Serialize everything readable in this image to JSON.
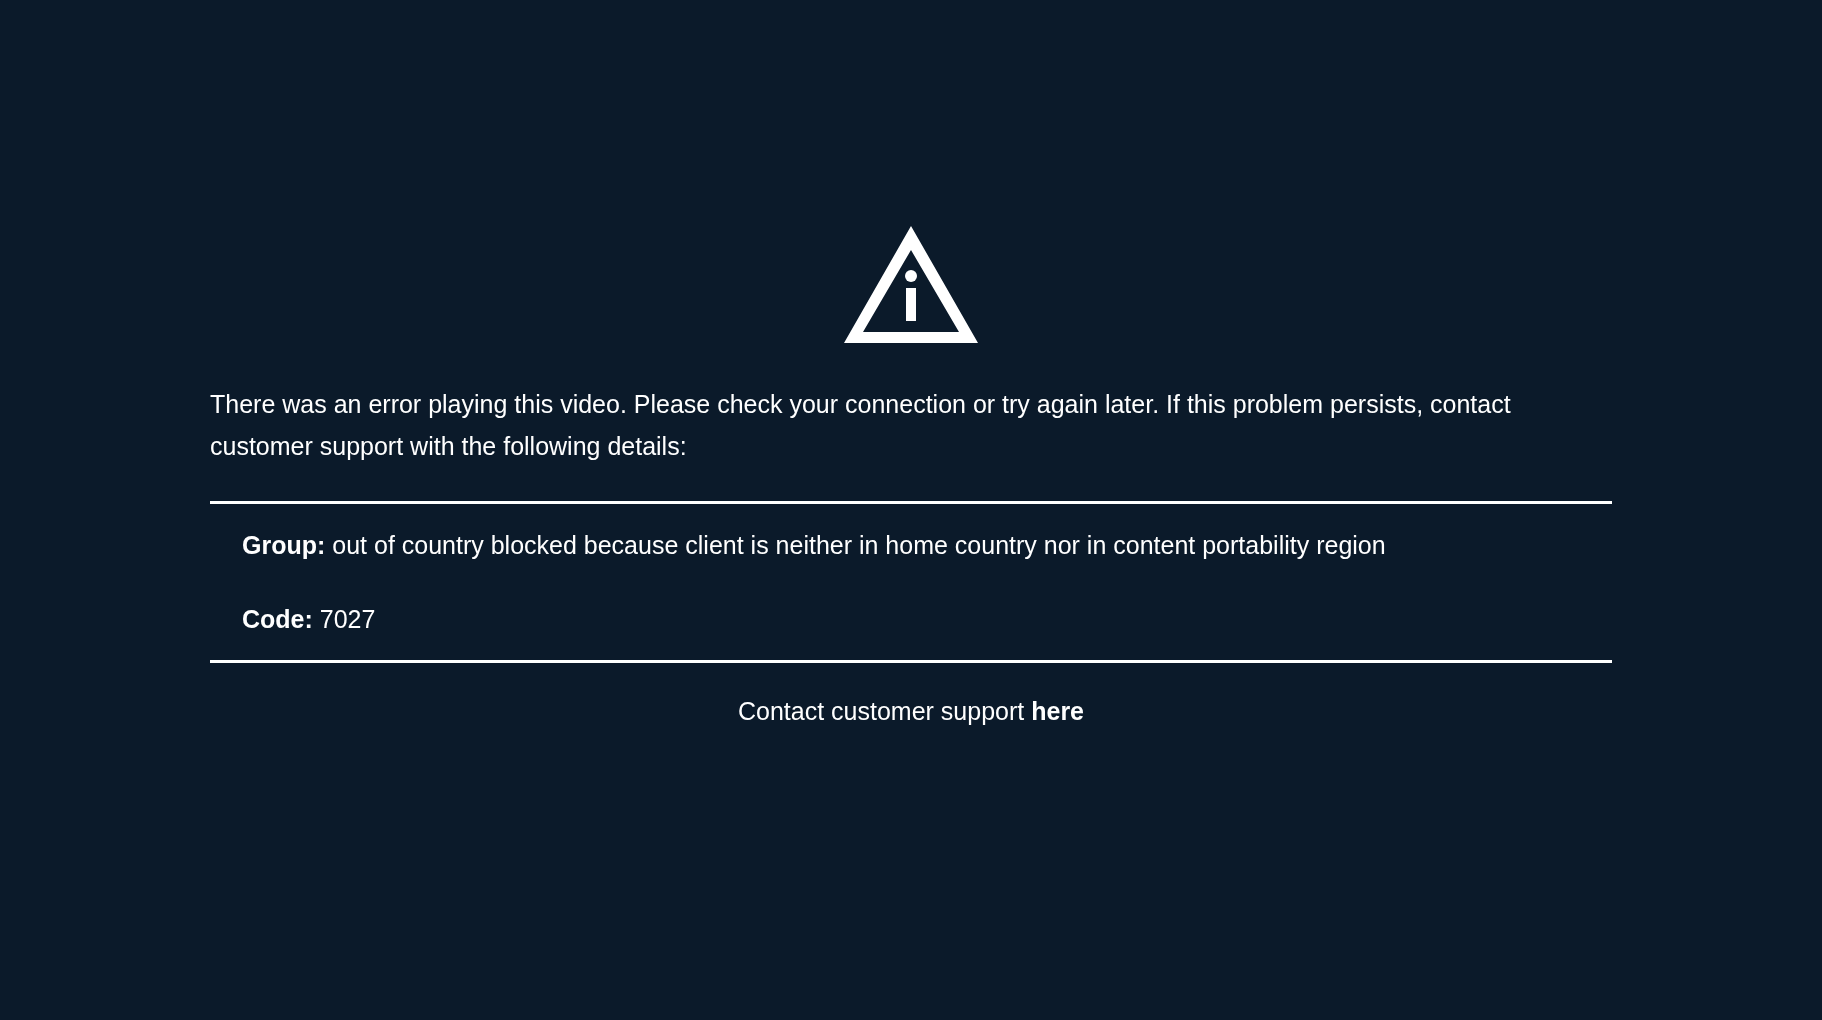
{
  "error": {
    "message": "There was an error playing this video. Please check your connection or try again later. If this problem persists, contact customer support with the following details:",
    "details": [
      "**Group:** out of country blocked because client is neither in home country nor in content portability region",
      "**Code:** 7027"
    ],
    "contact": {
      "text": "Contact customer support",
      "link": "here"
    }
  }
}
